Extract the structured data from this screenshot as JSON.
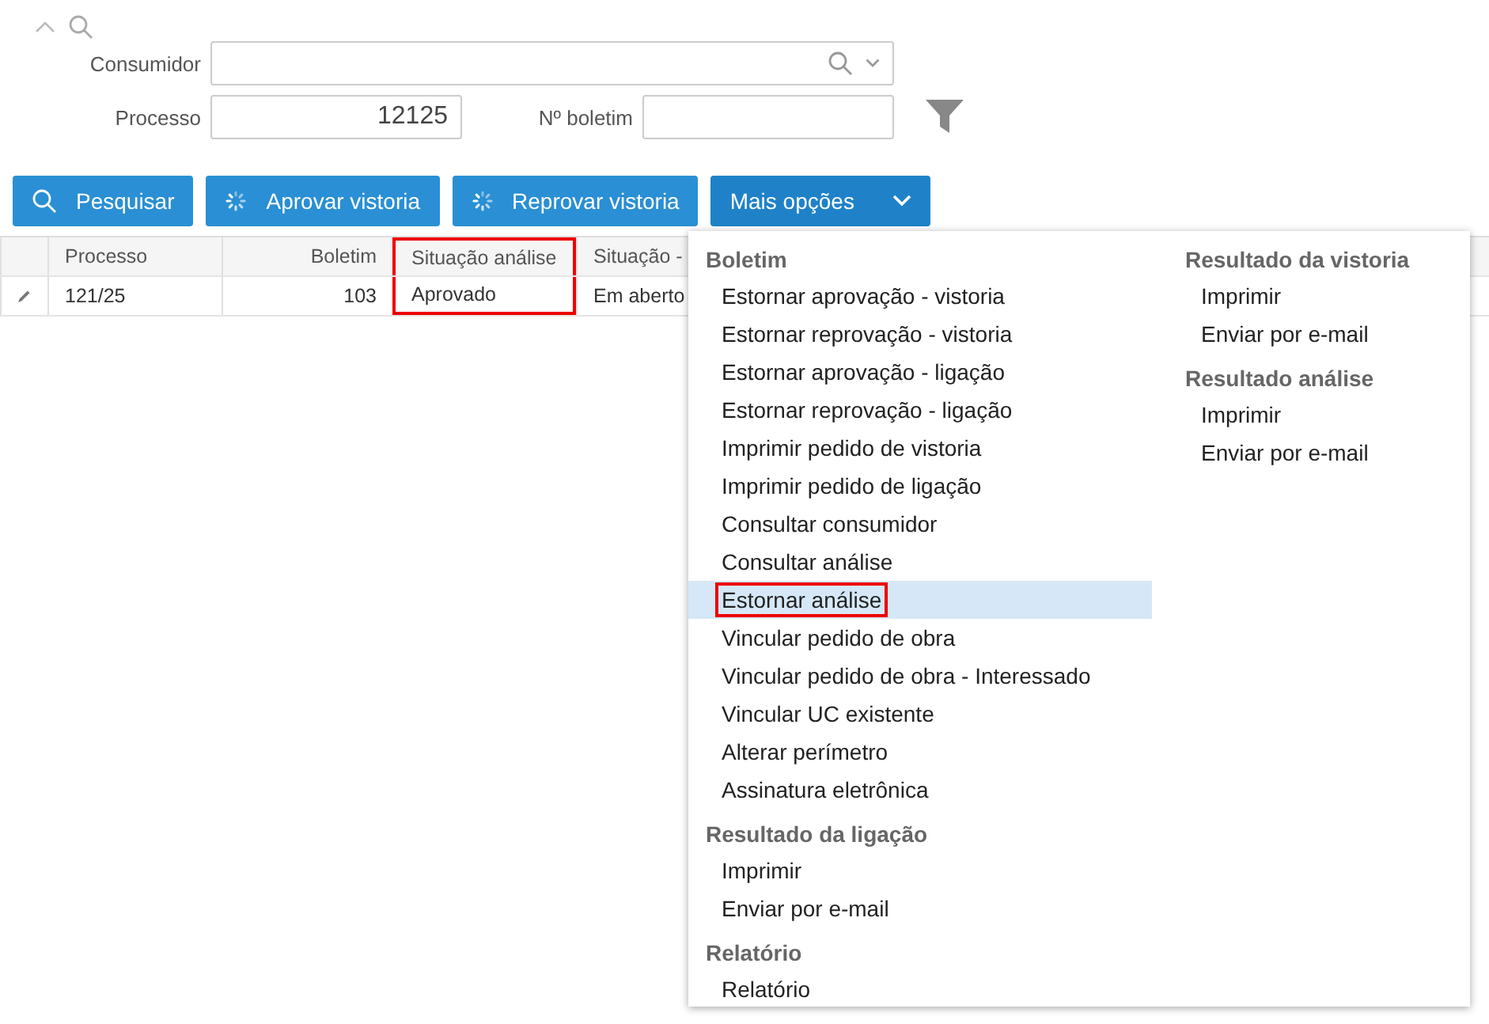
{
  "filter": {
    "fields": [
      {
        "label": "Consumidor",
        "kind": "lookup"
      },
      {
        "label": "Processo",
        "value": "12125",
        "kind": "number"
      },
      {
        "label": "Nº boletim",
        "kind": "text"
      }
    ]
  },
  "toolbar": [
    {
      "label": "Pesquisar",
      "kind": "search"
    },
    {
      "label": "Aprovar vistoria",
      "kind": "spinner"
    },
    {
      "label": "Reprovar vistoria",
      "kind": "spinner"
    },
    {
      "label": "Mais opções",
      "kind": "dropdown",
      "expanded": true
    }
  ],
  "table": {
    "columns": [
      {
        "label": "Processo",
        "kind": "text",
        "annotated": false
      },
      {
        "label": "Boletim",
        "kind": "number",
        "annotated": false
      },
      {
        "label": "Situação análise",
        "kind": "text",
        "annotated": true
      },
      {
        "label": "Situação -",
        "kind": "text",
        "annotated": false
      }
    ],
    "rows": [
      {
        "cells": [
          "121/25",
          "103",
          "Aprovado",
          "Em aberto"
        ]
      }
    ]
  },
  "menu": {
    "columns": [
      [
        {
          "heading": "Boletim",
          "items": [
            {
              "label": "Estornar aprovação - vistoria",
              "selected": false,
              "annotated": false
            },
            {
              "label": "Estornar reprovação - vistoria",
              "selected": false,
              "annotated": false
            },
            {
              "label": "Estornar aprovação - ligação",
              "selected": false,
              "annotated": false
            },
            {
              "label": "Estornar reprovação - ligação",
              "selected": false,
              "annotated": false
            },
            {
              "label": "Imprimir pedido de vistoria",
              "selected": false,
              "annotated": false
            },
            {
              "label": "Imprimir pedido de ligação",
              "selected": false,
              "annotated": false
            },
            {
              "label": "Consultar consumidor",
              "selected": false,
              "annotated": false
            },
            {
              "label": "Consultar análise",
              "selected": false,
              "annotated": false
            },
            {
              "label": "Estornar análise",
              "selected": true,
              "annotated": true
            },
            {
              "label": "Vincular pedido de obra",
              "selected": false,
              "annotated": false
            },
            {
              "label": "Vincular pedido de obra - Interessado",
              "selected": false,
              "annotated": false
            },
            {
              "label": "Vincular UC existente",
              "selected": false,
              "annotated": false
            },
            {
              "label": "Alterar perímetro",
              "selected": false,
              "annotated": false
            },
            {
              "label": "Assinatura eletrônica",
              "selected": false,
              "annotated": false
            }
          ]
        },
        {
          "heading": "Resultado da ligação",
          "items": [
            {
              "label": "Imprimir",
              "selected": false,
              "annotated": false
            },
            {
              "label": "Enviar por e-mail",
              "selected": false,
              "annotated": false
            }
          ]
        },
        {
          "heading": "Relatório",
          "items": [
            {
              "label": "Relatório",
              "selected": false,
              "annotated": false
            }
          ]
        }
      ],
      [
        {
          "heading": "Resultado da vistoria",
          "items": [
            {
              "label": "Imprimir",
              "selected": false,
              "annotated": false
            },
            {
              "label": "Enviar por e-mail",
              "selected": false,
              "annotated": false
            }
          ]
        },
        {
          "heading": "Resultado análise",
          "items": [
            {
              "label": "Imprimir",
              "selected": false,
              "annotated": false
            },
            {
              "label": "Enviar por e-mail",
              "selected": false,
              "annotated": false
            }
          ]
        }
      ]
    ]
  }
}
